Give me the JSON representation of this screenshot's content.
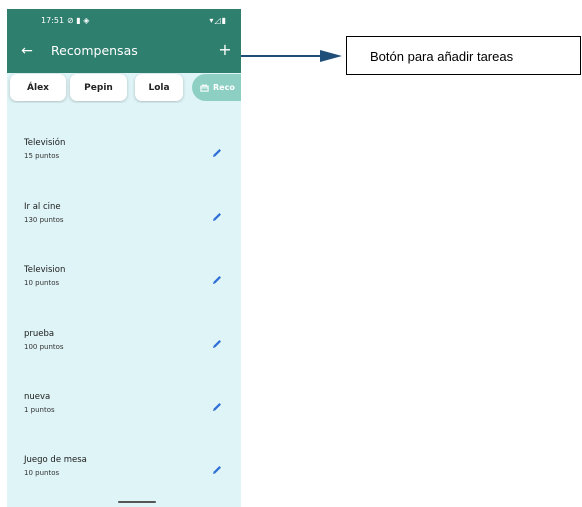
{
  "status_bar": {
    "time": "17:51",
    "left_icons": "⊘ ▮ ◈",
    "right_icons": "▾◿▮"
  },
  "app_bar": {
    "back_glyph": "←",
    "title": "Recompensas",
    "add_glyph": "+"
  },
  "chips": [
    {
      "label": "Álex"
    },
    {
      "label": "Pepin"
    },
    {
      "label": "Lola"
    }
  ],
  "selected_chip": {
    "label": "Reco",
    "icon": "gift-icon"
  },
  "rewards": [
    {
      "name": "Televisión",
      "points": "15 puntos"
    },
    {
      "name": "Ir al cine",
      "points": "130 puntos"
    },
    {
      "name": "Television",
      "points": "10 puntos"
    },
    {
      "name": "prueba",
      "points": "100 puntos"
    },
    {
      "name": "nueva",
      "points": "1 puntos"
    },
    {
      "name": "Juego de mesa",
      "points": "10 puntos"
    }
  ],
  "annotation": {
    "text": "Botón para añadir tareas"
  },
  "colors": {
    "app_bar": "#2f7f6f",
    "background": "#dff4f7",
    "chip_selected": "#8ecfc4",
    "edit_icon": "#2f6fd6",
    "arrow": "#1f4e79"
  }
}
